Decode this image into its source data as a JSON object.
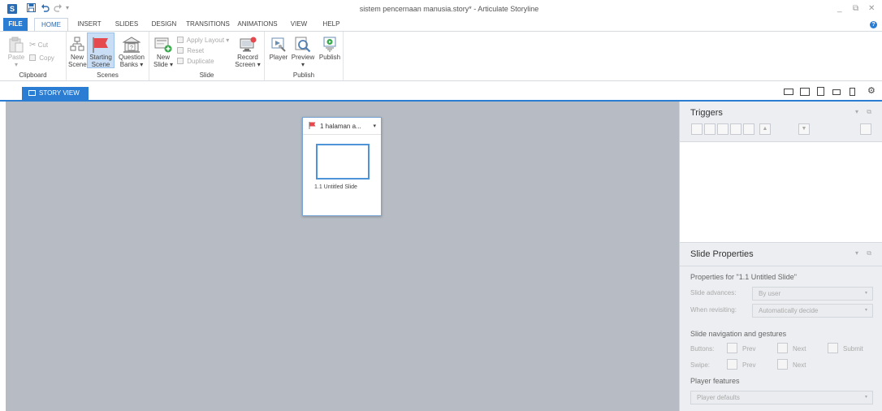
{
  "window": {
    "title": "sistem pencernaan manusia.story* - Articulate Storyline",
    "app_icon_letter": "S"
  },
  "quick_access": {
    "save_icon": "save-icon",
    "undo_icon": "undo-icon",
    "redo_icon": "redo-icon",
    "customize": "▾"
  },
  "window_controls": {
    "minimize": "_",
    "restore": "⧉",
    "close": "✕"
  },
  "ribbon_tabs": [
    "FILE",
    "HOME",
    "INSERT",
    "SLIDES",
    "DESIGN",
    "TRANSITIONS",
    "ANIMATIONS",
    "VIEW",
    "HELP"
  ],
  "help": "?",
  "ribbon": {
    "clipboard": {
      "label": "Clipboard",
      "paste": "Paste",
      "paste_arrow": "▾",
      "cut": "Cut",
      "copy": "Copy"
    },
    "scenes": {
      "label": "Scenes",
      "new_scene_l1": "New",
      "new_scene_l2": "Scene",
      "starting_scene_l1": "Starting",
      "starting_scene_l2": "Scene",
      "question_banks_l1": "Question",
      "question_banks_l2": "Banks ▾"
    },
    "slide": {
      "label": "Slide",
      "new_slide_l1": "New",
      "new_slide_l2": "Slide ▾",
      "apply_layout": "Apply Layout ▾",
      "reset": "Reset",
      "duplicate": "Duplicate",
      "record_screen_l1": "Record",
      "record_screen_l2": "Screen ▾"
    },
    "publish": {
      "label": "Publish",
      "player": "Player",
      "preview": "Preview",
      "preview_arrow": "▾",
      "publish": "Publish"
    }
  },
  "view_tab": {
    "label": "STORY VIEW"
  },
  "scene_card": {
    "title": "1 halaman a...",
    "caret": "▾",
    "slide_label": "1.1 Untitled Slide"
  },
  "triggers": {
    "title": "Triggers",
    "controls": "▾ ⧉",
    "buttons": [
      "new-trigger-icon",
      "edit-trigger-icon",
      "copy-trigger-icon",
      "paste-trigger-icon",
      "delete-trigger-icon",
      "move-up-icon",
      "move-down-icon"
    ],
    "up": "▲",
    "down": "▼"
  },
  "slide_properties": {
    "title": "Slide Properties",
    "controls": "▾ ⧉",
    "properties_for": "Properties for \"1.1 Untitled Slide\"",
    "slide_advances_label": "Slide advances:",
    "slide_advances_value": "By user",
    "when_revisiting_label": "When revisiting:",
    "when_revisiting_value": "Automatically decide",
    "nav_section": "Slide navigation and gestures",
    "buttons_label": "Buttons:",
    "swipe_label": "Swipe:",
    "prev": "Prev",
    "next": "Next",
    "submit": "Submit",
    "player_features": "Player features",
    "player_defaults": "Player defaults",
    "caret": "▾"
  },
  "colors": {
    "accent": "#2b7cd3",
    "canvas": "#b7bcc4",
    "panel": "#eceef1"
  }
}
